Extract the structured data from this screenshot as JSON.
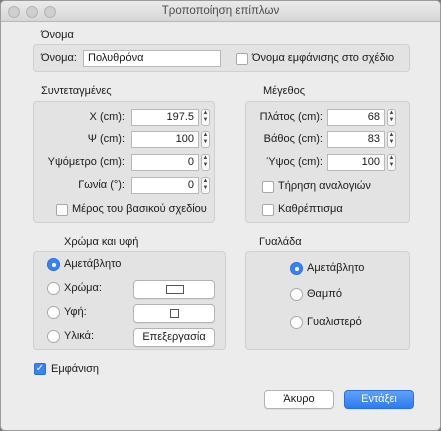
{
  "window": {
    "title": "Τροποποίηση επίπλων"
  },
  "name_section": {
    "title": "Όνομα",
    "name_label": "Όνομα:",
    "name_value": "Πολυθρόνα",
    "show_name_label": "Όνομα εμφάνισης στο σχέδιο",
    "show_name_checked": false
  },
  "coords": {
    "title": "Συντεταγμένες",
    "x_label": "X (cm):",
    "x_value": "197.5",
    "y_label": "Ψ (cm):",
    "y_value": "100",
    "elev_label": "Υψόμετρο (cm):",
    "elev_value": "0",
    "angle_label": "Γωνία (°):",
    "angle_value": "0",
    "base_plan_label": "Μέρος του βασικού σχεδίου",
    "base_plan_checked": false
  },
  "size": {
    "title": "Μέγεθος",
    "width_label": "Πλάτος (cm):",
    "width_value": "68",
    "depth_label": "Βάθος (cm):",
    "depth_value": "83",
    "height_label": "Ύψος (cm):",
    "height_value": "100",
    "keep_ratio_label": "Τήρηση αναλογιών",
    "keep_ratio_checked": false,
    "mirror_label": "Καθρέπτισμα",
    "mirror_checked": false
  },
  "color": {
    "title": "Χρώμα και υφή",
    "unchanged_label": "Αμετάβλητο",
    "color_label": "Χρώμα:",
    "texture_label": "Υφή:",
    "materials_label": "Υλικά:",
    "edit_button": "Επεξεργασία",
    "selected": "unchanged"
  },
  "gloss": {
    "title": "Γυαλάδα",
    "unchanged_label": "Αμετάβλητο",
    "matte_label": "Θαμπό",
    "glossy_label": "Γυαλιστερό",
    "selected": "unchanged"
  },
  "visible": {
    "label": "Εμφάνιση",
    "checked": true
  },
  "buttons": {
    "cancel": "Άκυρο",
    "ok": "Εντάξει"
  },
  "colors": {
    "accent": "#3a82f7",
    "panel": "#e3e3e3",
    "window_bg": "#ececec"
  }
}
